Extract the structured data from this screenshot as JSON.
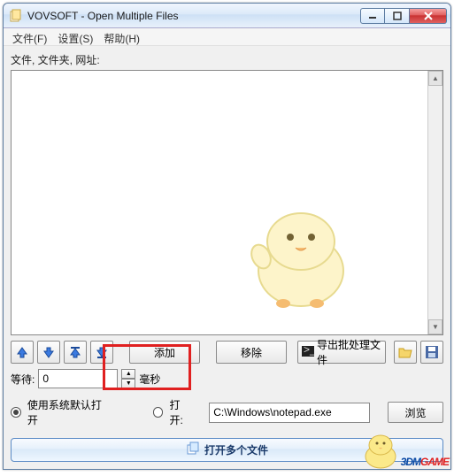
{
  "window": {
    "title": "VOVSOFT - Open Multiple Files"
  },
  "menu": {
    "file": "文件(F)",
    "settings": "设置(S)",
    "help": "帮助(H)"
  },
  "labels": {
    "list_label": "文件, 文件夹, 网址:",
    "wait_label": "等待:",
    "wait_value": "0",
    "wait_unit": "毫秒",
    "radio_default": "使用系统默认打开",
    "radio_open": "打开:",
    "path_value": "C:\\Windows\\notepad.exe"
  },
  "buttons": {
    "add": "添加",
    "remove": "移除",
    "export": "导出批处理文件",
    "browse": "浏览",
    "open_multi": "打开多个文件"
  },
  "icons": {
    "up": "arrow-up-icon",
    "down": "arrow-down-icon",
    "top": "move-top-icon",
    "bottom": "move-bottom-icon",
    "open_folder": "open-folder-icon",
    "save": "save-icon",
    "batch": "terminal-icon",
    "copy": "copy-icon"
  },
  "watermark": {
    "prefix": "3DM",
    "suffix": "GAME"
  }
}
